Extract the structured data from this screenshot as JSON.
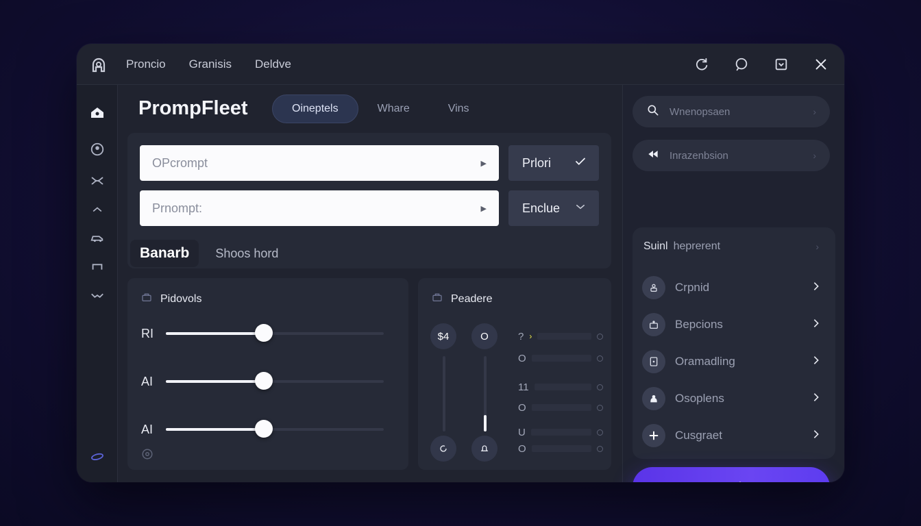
{
  "titlebar": {
    "menu": [
      "Proncio",
      "Granisis",
      "Deldve"
    ]
  },
  "app": {
    "title": "PrompFleet"
  },
  "tabs": [
    {
      "label": "Oineptels",
      "active": true
    },
    {
      "label": "Whare",
      "active": false
    },
    {
      "label": "Vins",
      "active": false
    }
  ],
  "prompt": {
    "input1_placeholder": "OPcrompt",
    "input2_placeholder": "Prnompt:",
    "btn1_label": "Prlori",
    "btn2_label": "Enclue"
  },
  "sub_tabs": [
    {
      "label": "Banarb",
      "active": true
    },
    {
      "label": "Shoos hord",
      "active": false
    }
  ],
  "pidovols": {
    "title": "Pidovols",
    "sliders": [
      {
        "label": "RI",
        "value": 0.45
      },
      {
        "label": "AI",
        "value": 0.45
      },
      {
        "label": "AI",
        "value": 0.45
      }
    ]
  },
  "peadere": {
    "title": "Peadere",
    "columns": [
      {
        "top_label": "$4",
        "level": 0.0
      },
      {
        "top_label": "O",
        "level": 0.22
      }
    ],
    "rows": [
      {
        "label": "?"
      },
      {
        "label": "O"
      },
      {
        "label": "11"
      },
      {
        "label": "O"
      },
      {
        "label": "U"
      },
      {
        "label": "O"
      }
    ]
  },
  "right": {
    "search_placeholder": "Wnenopsaen",
    "pill2_label": "Inrazenbsion",
    "list_head_left": "Suinl",
    "list_head_right": "heprerent",
    "items": [
      {
        "label": "Crpnid",
        "icon": "person-icon"
      },
      {
        "label": "Bepcions",
        "icon": "briefcase-icon"
      },
      {
        "label": "Oramadling",
        "icon": "document-icon"
      },
      {
        "label": "Osoplens",
        "icon": "group-icon"
      },
      {
        "label": "Cusgraet",
        "icon": "plus-icon"
      }
    ],
    "cta_label": "Rosslat"
  }
}
